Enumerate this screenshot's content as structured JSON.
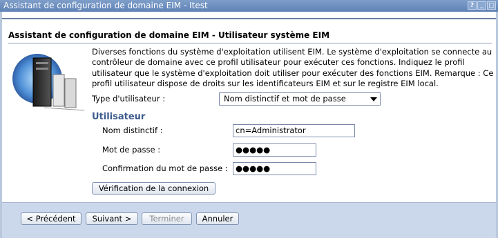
{
  "window": {
    "title": "Assistant de configuration de domaine EIM - Itest",
    "controls": [
      "?",
      "_",
      "□"
    ]
  },
  "page": {
    "title": "Assistant de configuration de domaine EIM - Utilisateur système EIM",
    "image_icon": "server-network-icon",
    "description": "Diverses fonctions du système d'exploitation utilisent EIM. Le système d'exploitation se connecte au contrôleur de domaine avec ce profil utilisateur pour exécuter ces fonctions. Indiquez le profil utilisateur que le système d'exploitation doit utiliser pour exécuter des fonctions EIM. Remarque : Ce profil utilisateur dispose de droits sur les identificateurs EIM et sur le registre EIM local."
  },
  "form": {
    "user_type_label": "Type d'utilisateur :",
    "user_type_value": "Nom distinctif et mot de passe",
    "section_title": "Utilisateur",
    "dn_label": "Nom distinctif :",
    "dn_value": "cn=Administrator",
    "password_label": "Mot de passe :",
    "password_value": "●●●●●",
    "confirm_label": "Confirmation du mot de passe :",
    "confirm_value": "●●●●●",
    "verify_button": "Vérification de la connexion"
  },
  "footer": {
    "back": "< Précédent",
    "next": "Suivant >",
    "finish": "Terminer",
    "cancel": "Annuler"
  }
}
